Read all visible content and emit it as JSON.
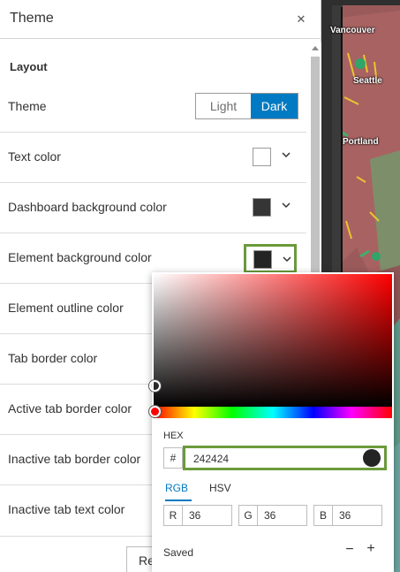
{
  "panel": {
    "title": "Theme",
    "close_icon": "close-icon",
    "section_title": "Layout",
    "reset_label": "Reset"
  },
  "theme_row": {
    "label": "Theme",
    "options": [
      "Light",
      "Dark"
    ],
    "selected": "Dark"
  },
  "color_rows": [
    {
      "label": "Text color",
      "swatch": "#ffffff"
    },
    {
      "label": "Dashboard background color",
      "swatch": "#353535"
    },
    {
      "label": "Element background color",
      "swatch": "#242424",
      "selected": true
    },
    {
      "label": "Element outline color"
    },
    {
      "label": "Tab border color"
    },
    {
      "label": "Active tab border color"
    },
    {
      "label": "Inactive tab border color"
    },
    {
      "label": "Inactive tab text color"
    }
  ],
  "picker": {
    "hex_label": "HEX",
    "hash": "#",
    "hex_value": "242424",
    "tabs": [
      "RGB",
      "HSV"
    ],
    "active_tab": "RGB",
    "channels": [
      {
        "label": "R",
        "value": "36"
      },
      {
        "label": "G",
        "value": "36"
      },
      {
        "label": "B",
        "value": "36"
      }
    ],
    "saved_label": "Saved",
    "remove_symbol": "−",
    "add_symbol": "+"
  },
  "map": {
    "labels": [
      "Vancouver",
      "Seattle",
      "Portland"
    ]
  },
  "colors": {
    "accent": "#007ac2",
    "selection_outline": "#6b9a3b",
    "current_color": "#242424"
  }
}
